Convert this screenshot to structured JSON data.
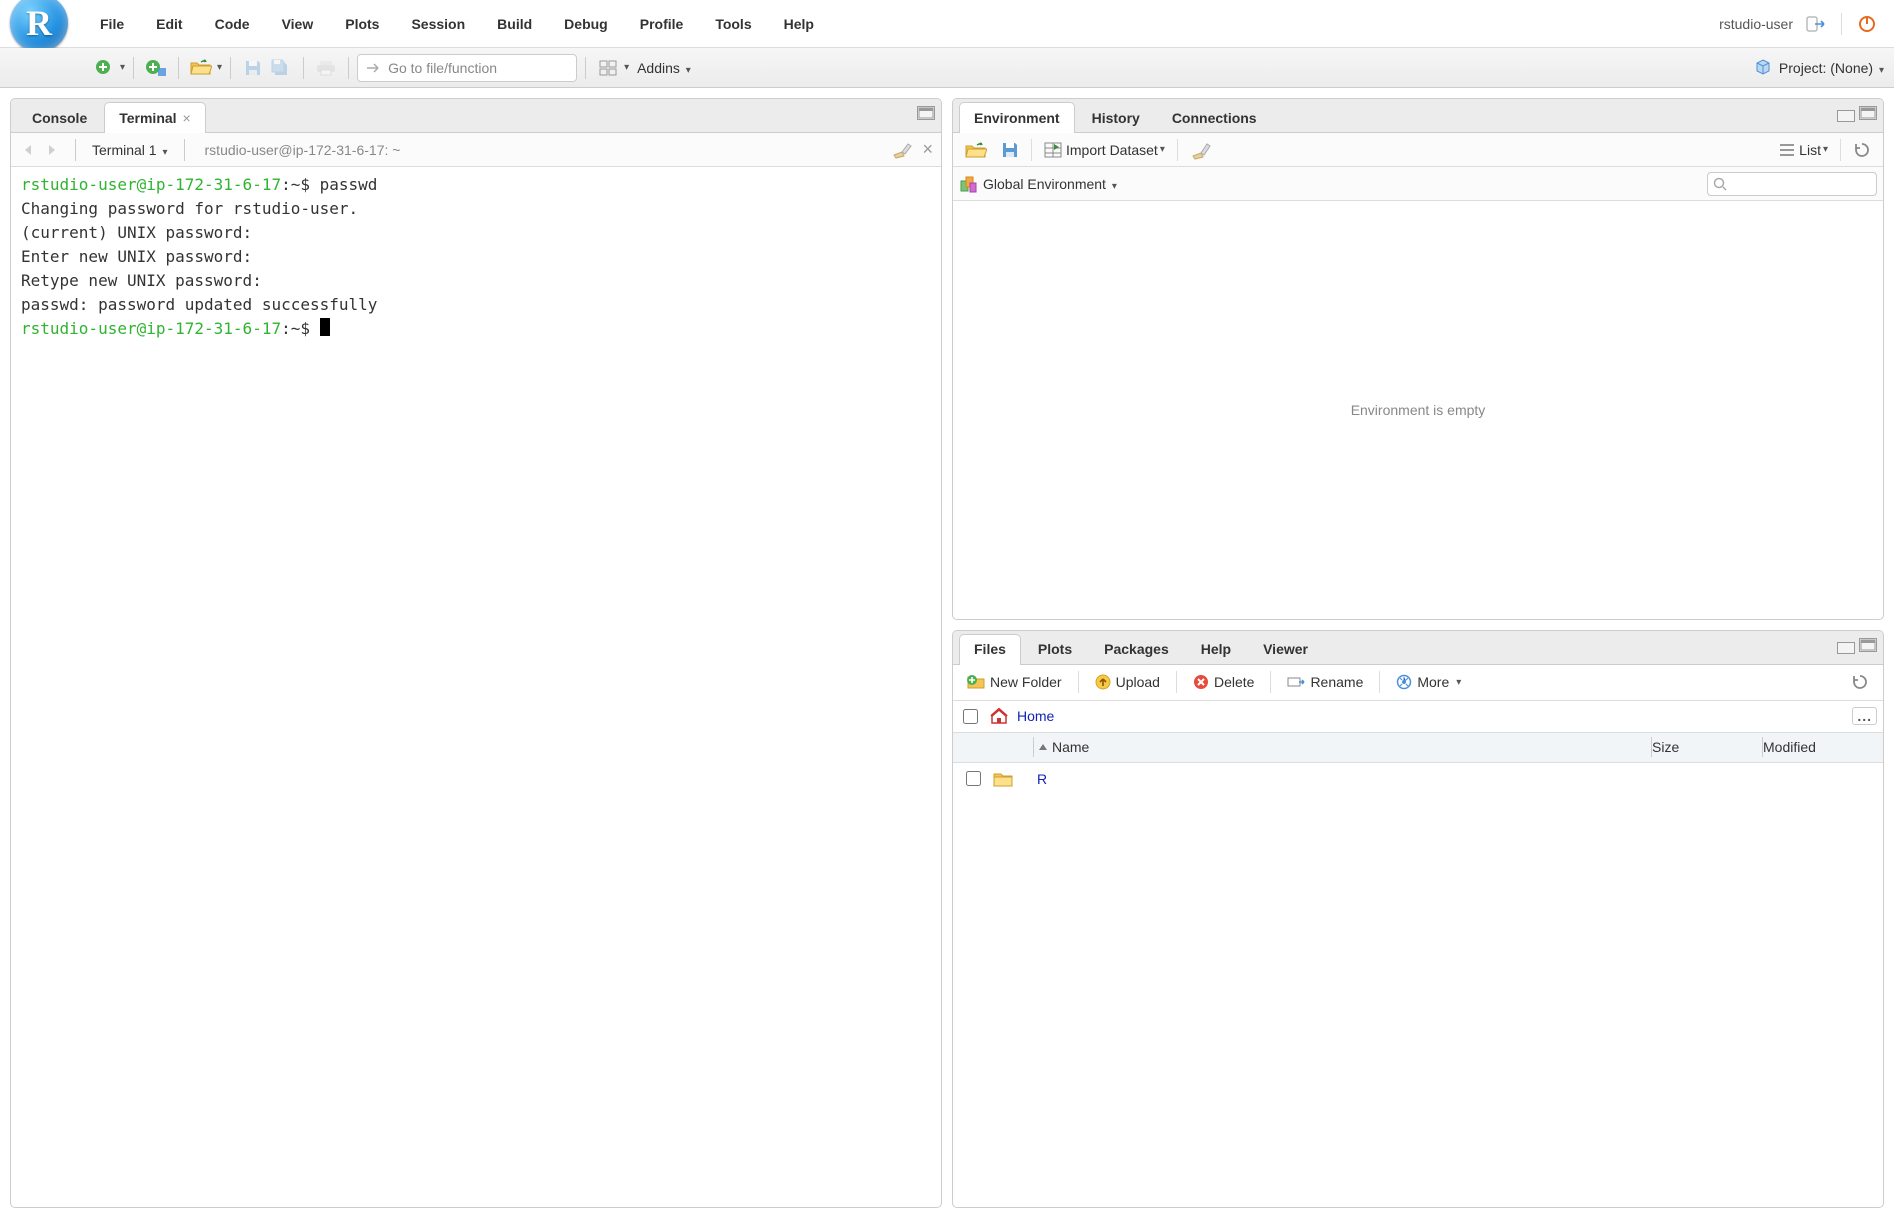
{
  "menubar": {
    "items": [
      "File",
      "Edit",
      "Code",
      "View",
      "Plots",
      "Session",
      "Build",
      "Debug",
      "Profile",
      "Tools",
      "Help"
    ],
    "user": "rstudio-user"
  },
  "toolbar": {
    "goto_placeholder": "Go to file/function",
    "addins_label": "Addins",
    "project_label": "Project: (None)"
  },
  "left_pane": {
    "tabs": [
      "Console",
      "Terminal"
    ],
    "active_tab": 1,
    "terminal_selector": "Terminal 1",
    "terminal_path": "rstudio-user@ip-172-31-6-17: ~",
    "terminal_lines": [
      {
        "prompt": "rstudio-user@ip-172-31-6-17",
        "sep": ":",
        "cwd": "~",
        "dollar": "$ ",
        "text": "passwd"
      },
      {
        "text": "Changing password for rstudio-user."
      },
      {
        "text": "(current) UNIX password:"
      },
      {
        "text": "Enter new UNIX password:"
      },
      {
        "text": "Retype new UNIX password:"
      },
      {
        "text": "passwd: password updated successfully"
      },
      {
        "prompt": "rstudio-user@ip-172-31-6-17",
        "sep": ":",
        "cwd": "~",
        "dollar": "$ ",
        "cursor": true
      }
    ]
  },
  "env_pane": {
    "tabs": [
      "Environment",
      "History",
      "Connections"
    ],
    "active_tab": 0,
    "import_label": "Import Dataset",
    "list_label": "List",
    "scope_label": "Global Environment",
    "empty_text": "Environment is empty"
  },
  "files_pane": {
    "tabs": [
      "Files",
      "Plots",
      "Packages",
      "Help",
      "Viewer"
    ],
    "active_tab": 0,
    "buttons": {
      "new_folder": "New Folder",
      "upload": "Upload",
      "delete": "Delete",
      "rename": "Rename",
      "more": "More"
    },
    "breadcrumb": "Home",
    "columns": {
      "name": "Name",
      "size": "Size",
      "modified": "Modified"
    },
    "rows": [
      {
        "name": "R",
        "type": "folder"
      }
    ]
  }
}
